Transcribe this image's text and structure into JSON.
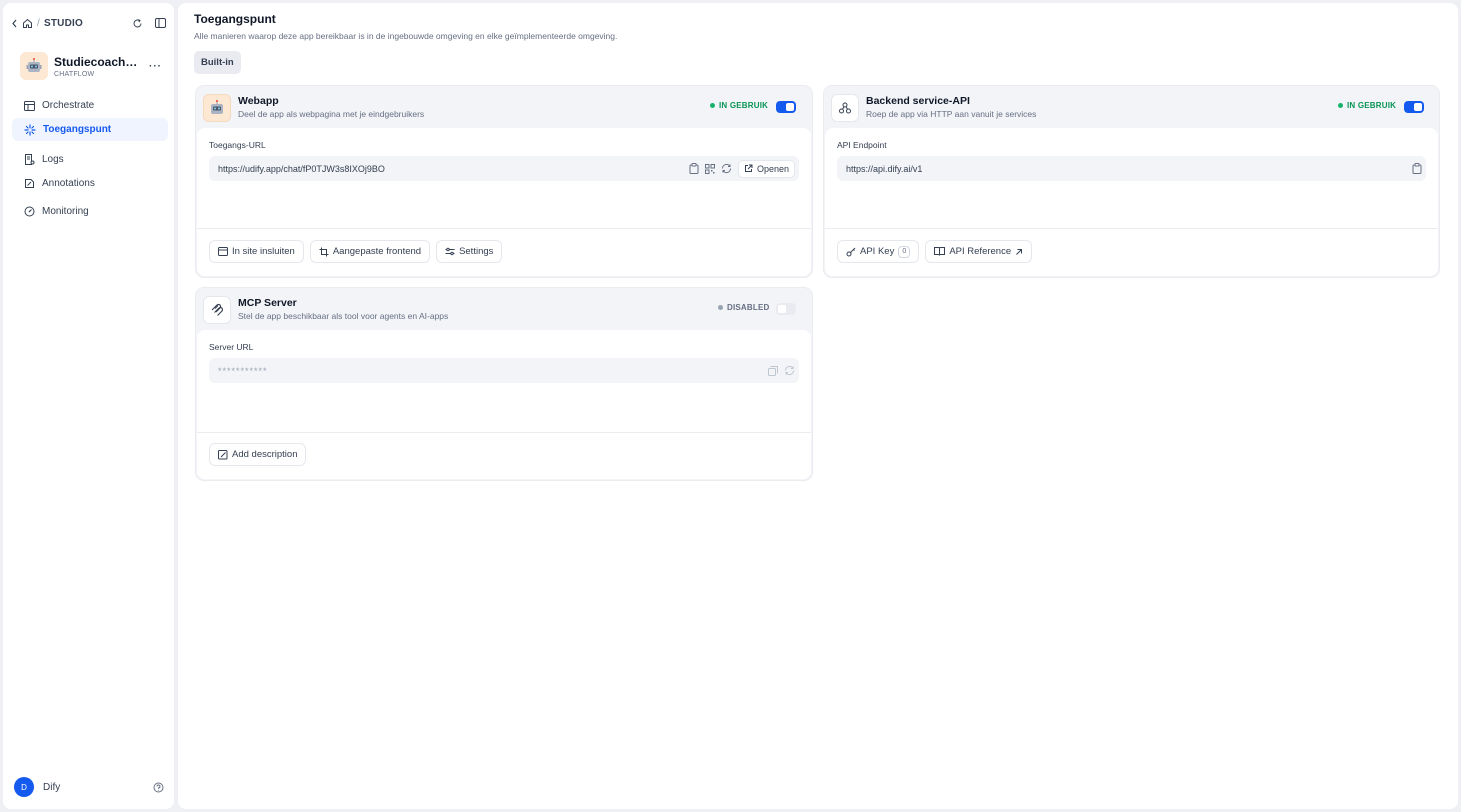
{
  "sidebar": {
    "breadcrumb": "STUDIO",
    "app": {
      "name": "Studiecoach bi...",
      "type": "CHATFLOW"
    },
    "nav": [
      {
        "label": "Orchestrate",
        "icon": "layout-icon"
      },
      {
        "label": "Toegangspunt",
        "icon": "sparkle-icon",
        "active": true
      },
      {
        "label": "Logs",
        "icon": "file-list-icon"
      },
      {
        "label": "Annotations",
        "icon": "annotation-icon"
      },
      {
        "label": "Monitoring",
        "icon": "gauge-icon"
      }
    ],
    "user": {
      "initial": "D",
      "name": "Dify"
    }
  },
  "page": {
    "title": "Toegangspunt",
    "subtitle": "Alle manieren waarop deze app bereikbaar is in de ingebouwde omgeving en elke geïmplementeerde omgeving.",
    "tab": "Built-in"
  },
  "webapp": {
    "title": "Webapp",
    "desc": "Deel de app als webpagina met je eindgebruikers",
    "status": "IN GEBRUIK",
    "enabled": true,
    "field_label": "Toegangs-URL",
    "url": "https://udify.app/chat/fP0TJW3s8IXOj9BO",
    "open_label": "Openen",
    "buttons": [
      "In site insluiten",
      "Aangepaste frontend",
      "Settings"
    ]
  },
  "backend": {
    "title": "Backend service-API",
    "desc": "Roep de app via HTTP aan vanuit je services",
    "status": "IN GEBRUIK",
    "enabled": true,
    "field_label": "API Endpoint",
    "url": "https://api.dify.ai/v1",
    "api_key_label": "API Key",
    "api_key_count": "0",
    "api_ref_label": "API Reference"
  },
  "mcp": {
    "title": "MCP Server",
    "desc": "Stel de app beschikbaar als tool voor agents en AI-apps",
    "status": "DISABLED",
    "enabled": false,
    "field_label": "Server URL",
    "url": "***********",
    "button": "Add description"
  },
  "colors": {
    "accent": "#155aef",
    "success": "#17b26a",
    "app_icon_bg": "#fde8d3"
  }
}
